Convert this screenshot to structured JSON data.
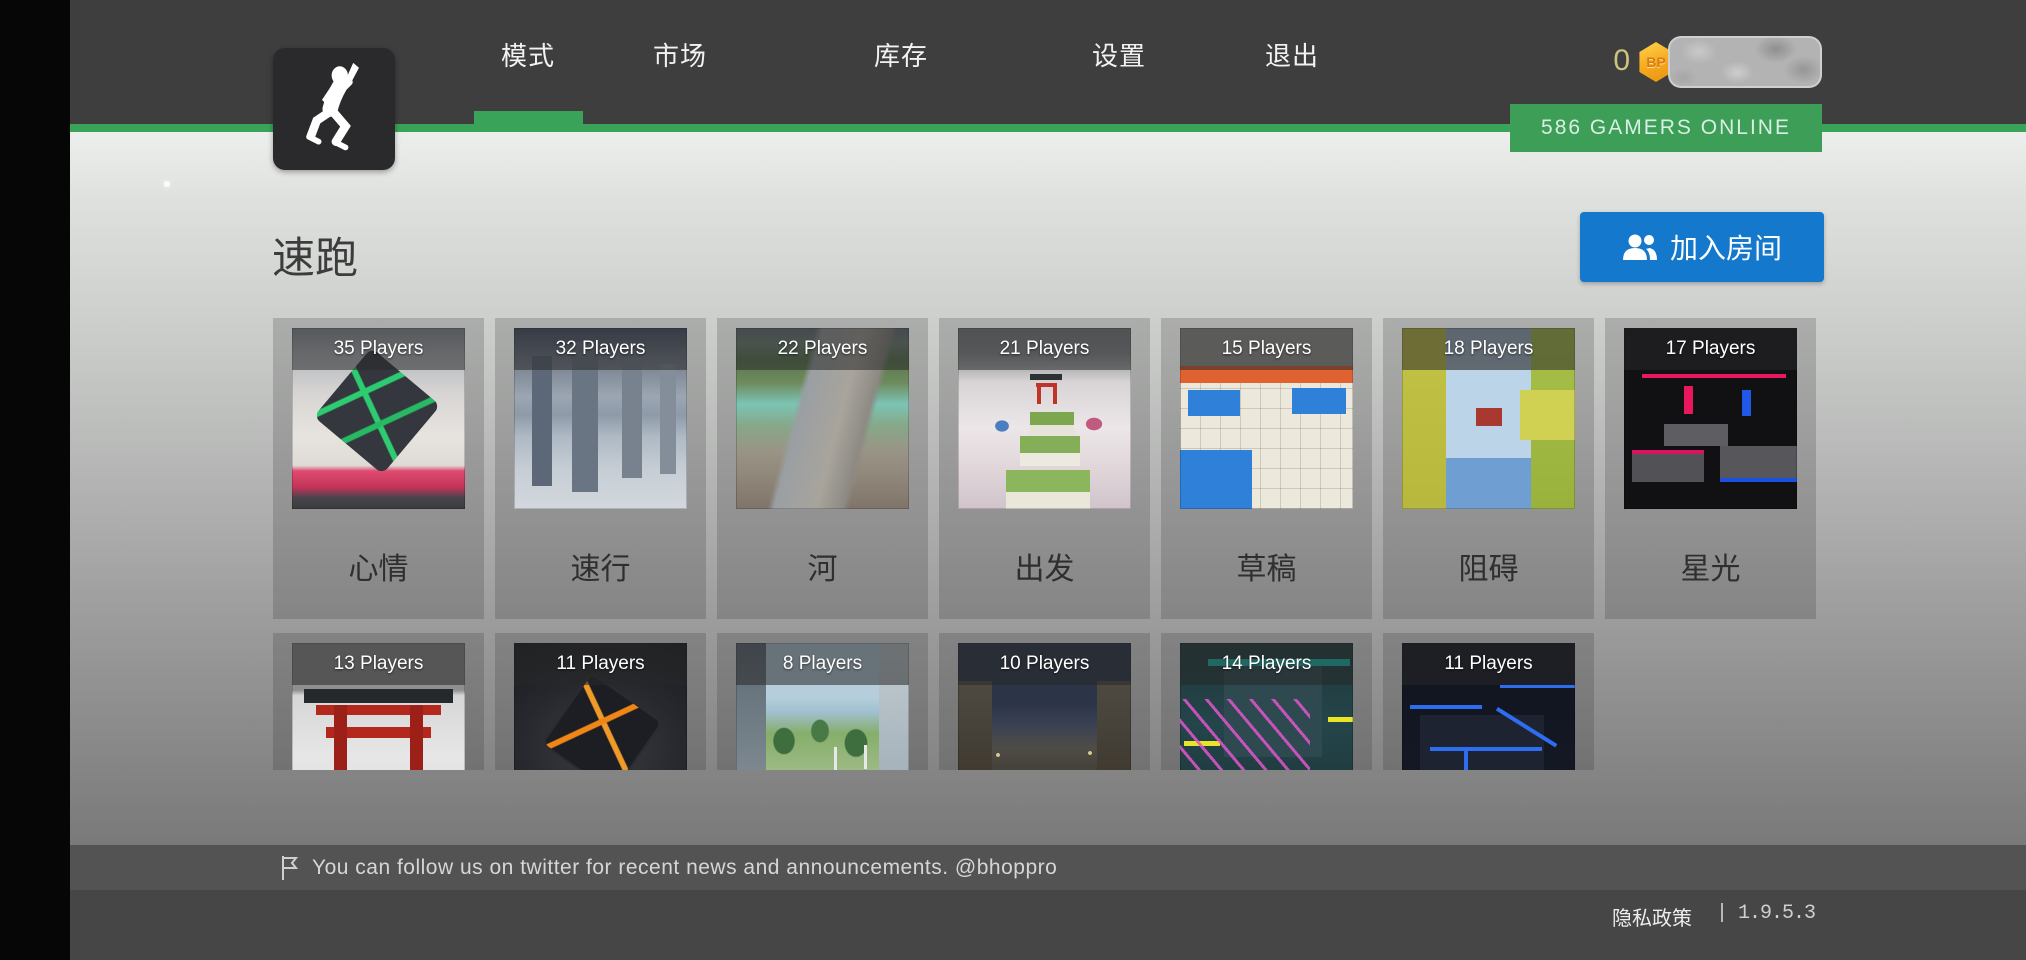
{
  "header": {
    "nav": [
      {
        "label": "模式",
        "active": true
      },
      {
        "label": "市场",
        "active": false
      },
      {
        "label": "库存",
        "active": false
      },
      {
        "label": "设置",
        "active": false
      },
      {
        "label": "退出",
        "active": false
      }
    ],
    "bp_count": "0",
    "bp_badge_label": "BP",
    "online_banner": "586 GAMERS ONLINE"
  },
  "main": {
    "page_title": "速跑",
    "join_room_button": "加入房间"
  },
  "cards": {
    "row1": [
      {
        "name": "心情",
        "players": "35 Players",
        "thumb": "cloud-cube-green"
      },
      {
        "name": "速行",
        "players": "32 Players",
        "thumb": "pillars"
      },
      {
        "name": "河",
        "players": "22 Players",
        "thumb": "river"
      },
      {
        "name": "出发",
        "players": "21 Players",
        "thumb": "sky-grass-path"
      },
      {
        "name": "草稿",
        "players": "15 Players",
        "thumb": "draft-tiles"
      },
      {
        "name": "阻碍",
        "players": "18 Players",
        "thumb": "obstacle-boxes"
      },
      {
        "name": "星光",
        "players": "17 Players",
        "thumb": "starlight-neon"
      }
    ],
    "row2": [
      {
        "players": "13 Players",
        "thumb": "torii"
      },
      {
        "players": "11 Players",
        "thumb": "dark-cube-orange"
      },
      {
        "players": "8 Players",
        "thumb": "green-alley"
      },
      {
        "players": "10 Players",
        "thumb": "night-corridor"
      },
      {
        "players": "14 Players",
        "thumb": "neon-pink-track"
      },
      {
        "players": "11 Players",
        "thumb": "neon-blue-cubes"
      }
    ]
  },
  "ticker": {
    "message": "You can follow us on twitter for recent news and announcements. @bhoppro"
  },
  "footer": {
    "privacy_policy": "隐私政策",
    "version": "| 1.9.5.3"
  },
  "icons": {
    "logo": "jumping-player-icon",
    "join_button": "people-icon",
    "ticker": "flag-icon",
    "currency": "bp-hexagon-icon"
  },
  "colors": {
    "accent_green": "#3aa35a",
    "online_badge_green": "#3d9e58",
    "join_button_blue": "#1478cd",
    "bp_gold": "#f5a91f",
    "header_gray": "#3e3e3e"
  }
}
